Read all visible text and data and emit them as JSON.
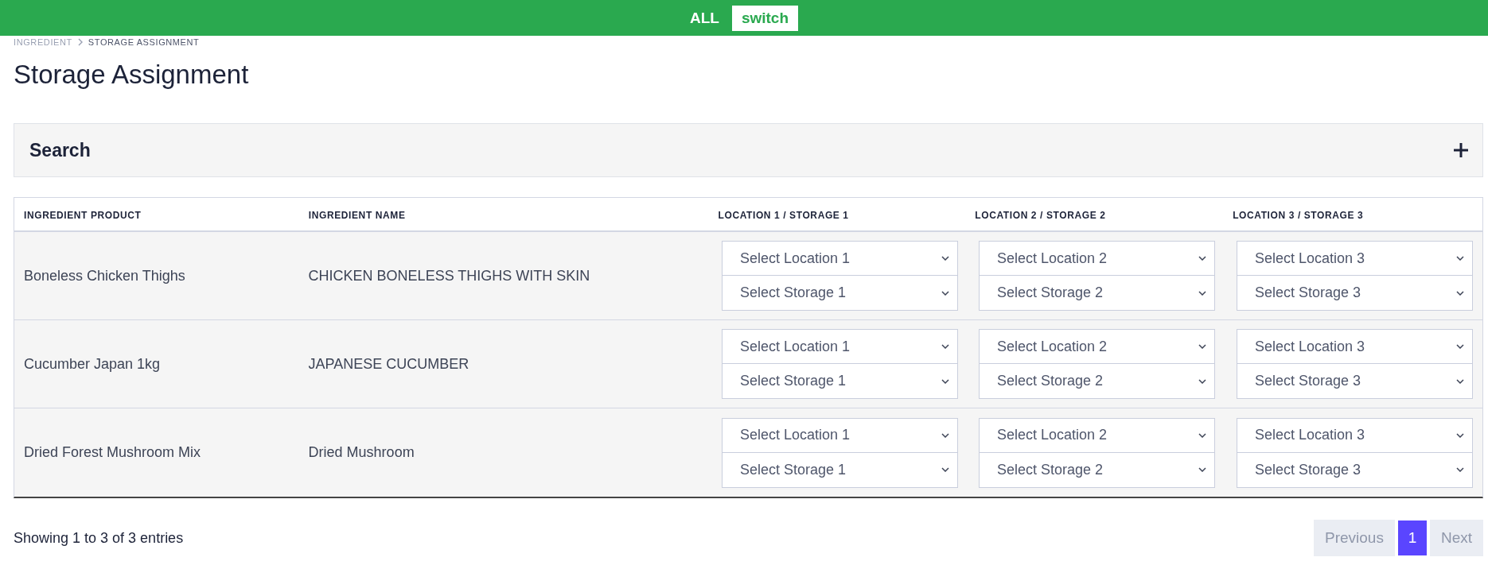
{
  "top_bar": {
    "label": "ALL",
    "button": "switch"
  },
  "breadcrumb": [
    {
      "label": "INGREDIENT",
      "current": false
    },
    {
      "label": "STORAGE ASSIGNMENT",
      "current": true
    }
  ],
  "title": "Storage Assignment",
  "search_panel": {
    "title": "Search",
    "expanded": false
  },
  "table": {
    "columns": [
      "INGREDIENT PRODUCT",
      "INGREDIENT NAME",
      "LOCATION 1 / STORAGE 1",
      "LOCATION 2 / STORAGE 2",
      "LOCATION 3 / STORAGE 3"
    ],
    "rows": [
      {
        "product": "Boneless Chicken Thighs",
        "name": "CHICKEN BONELESS THIGHS WITH SKIN",
        "slots": [
          {
            "location": "Select Location 1",
            "storage": "Select Storage 1"
          },
          {
            "location": "Select Location 2",
            "storage": "Select Storage 2"
          },
          {
            "location": "Select Location 3",
            "storage": "Select Storage 3"
          }
        ]
      },
      {
        "product": "Cucumber Japan 1kg",
        "name": "JAPANESE CUCUMBER",
        "slots": [
          {
            "location": "Select Location 1",
            "storage": "Select Storage 1"
          },
          {
            "location": "Select Location 2",
            "storage": "Select Storage 2"
          },
          {
            "location": "Select Location 3",
            "storage": "Select Storage 3"
          }
        ]
      },
      {
        "product": "Dried Forest Mushroom Mix",
        "name": "Dried Mushroom",
        "slots": [
          {
            "location": "Select Location 1",
            "storage": "Select Storage 1"
          },
          {
            "location": "Select Location 2",
            "storage": "Select Storage 2"
          },
          {
            "location": "Select Location 3",
            "storage": "Select Storage 3"
          }
        ]
      }
    ]
  },
  "footer": {
    "info": "Showing 1 to 3 of 3 entries",
    "pagination": [
      {
        "label": "Previous",
        "kind": "prev",
        "selected": false,
        "disabled": true
      },
      {
        "label": "1",
        "kind": "page",
        "selected": true,
        "disabled": false
      },
      {
        "label": "Next",
        "kind": "next",
        "selected": false,
        "disabled": true
      }
    ]
  }
}
